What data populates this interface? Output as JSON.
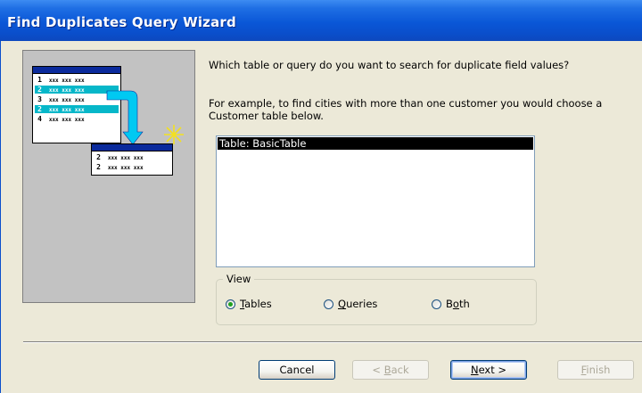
{
  "window": {
    "title": "Find Duplicates Query Wizard"
  },
  "illustration": {
    "source_rows": [
      {
        "num": "1",
        "text": "xxx xxx xxx",
        "highlighted": false
      },
      {
        "num": "2",
        "text": "xxx xxx xxx",
        "highlighted": true
      },
      {
        "num": "3",
        "text": "xxx xxx xxx",
        "highlighted": false
      },
      {
        "num": "2",
        "text": "xxx xxx xxx",
        "highlighted": true
      },
      {
        "num": "4",
        "text": "xxx xxx xxx",
        "highlighted": false
      }
    ],
    "result_rows": [
      {
        "num": "2",
        "text": "xxx xxx xxx"
      },
      {
        "num": "2",
        "text": "xxx xxx xxx"
      }
    ]
  },
  "content": {
    "prompt": "Which table or query do you want to search for duplicate field values?",
    "example": "For example, to find cities with more than one customer you would choose a Customer table below."
  },
  "list": {
    "items": [
      "Table: BasicTable"
    ],
    "selected_index": 0
  },
  "view": {
    "label": "View",
    "options": [
      {
        "pre": "",
        "key": "T",
        "post": "ables",
        "checked": true
      },
      {
        "pre": "",
        "key": "Q",
        "post": "ueries",
        "checked": false
      },
      {
        "pre": "B",
        "key": "o",
        "post": "th",
        "checked": false
      }
    ]
  },
  "buttons": {
    "cancel": "Cancel",
    "back": {
      "pre": "< ",
      "key": "B",
      "post": "ack"
    },
    "next": {
      "pre": "",
      "key": "N",
      "post": "ext >"
    },
    "finish": {
      "pre": "",
      "key": "F",
      "post": "inish"
    }
  },
  "colors": {
    "title_bar": "#0a57d7",
    "highlight_row": "#06b7c9",
    "selection": "#000000"
  }
}
